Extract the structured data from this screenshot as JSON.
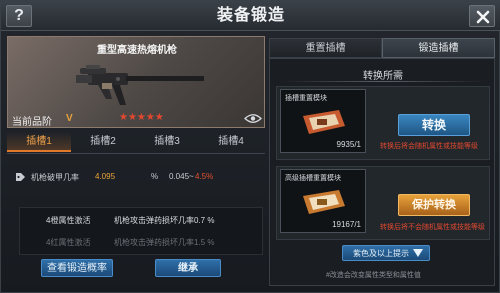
{
  "window": {
    "title": "装备锻造"
  },
  "header": {
    "help_label": "?"
  },
  "weapon": {
    "name": "重型高速热熔机枪",
    "quality_label": "当前品阶",
    "quality_value": "V",
    "stars": "★★★★★",
    "star_count": 5
  },
  "slots": {
    "tabs": [
      "插槽1",
      "插槽2",
      "插槽3",
      "插槽4"
    ],
    "active_index": 0
  },
  "attribute": {
    "name": "机枪破甲几率",
    "value": "4.095",
    "unit": "%",
    "range_min": "0.045~",
    "range_max": "4.5%"
  },
  "bonuses": [
    {
      "level": "4橙属性激活",
      "desc": "机枪攻击弹药损坏几率0.7 %",
      "active": true
    },
    {
      "level": "4红属性激活",
      "desc": "机枪攻击弹药损坏几率1.5 %",
      "active": false
    }
  ],
  "buttons": {
    "view_prob": "查看锻造概率",
    "inherit": "继承"
  },
  "right_tabs": {
    "reset": "重置插槽",
    "forge": "锻造插槽"
  },
  "conversion": {
    "title": "转换所需",
    "module1": {
      "name": "插槽重置模块",
      "count": "9935/1"
    },
    "module2": {
      "name": "高级插槽重置模块",
      "count": "19167/1"
    },
    "convert_label": "转换",
    "convert_note": "转换后将会随机属性或技能等级",
    "protect_label": "保护转换",
    "protect_note": "转换后将不会随机属性或技能等级",
    "filter_label": "紫色及以上提示",
    "footnote": "#改造会改变属性类型和属性值"
  },
  "colors": {
    "accent_orange": "#e8a23a",
    "accent_red": "#e2482e",
    "button_blue": "#2f6fa8"
  }
}
